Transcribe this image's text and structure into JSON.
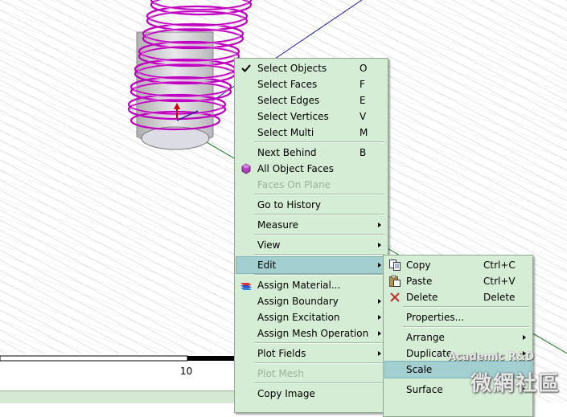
{
  "context_menu": {
    "items": [
      {
        "label": "Select Objects",
        "shortcut": "O",
        "checked": true
      },
      {
        "label": "Select Faces",
        "shortcut": "F"
      },
      {
        "label": "Select Edges",
        "shortcut": "E"
      },
      {
        "label": "Select Vertices",
        "shortcut": "V"
      },
      {
        "label": "Select Multi",
        "shortcut": "M"
      },
      {
        "label": "Next Behind",
        "shortcut": "B"
      },
      {
        "label": "All Object Faces",
        "icon": "purple-cube-icon"
      },
      {
        "label": "Faces On Plane",
        "disabled": true
      },
      {
        "label": "Go to History"
      },
      {
        "label": "Measure",
        "submenu": true
      },
      {
        "label": "View",
        "submenu": true
      },
      {
        "label": "Edit",
        "submenu": true,
        "highlighted": true
      },
      {
        "label": "Assign Material...",
        "icon": "material-layers-icon"
      },
      {
        "label": "Assign Boundary",
        "submenu": true
      },
      {
        "label": "Assign Excitation",
        "submenu": true
      },
      {
        "label": "Assign Mesh Operation",
        "submenu": true
      },
      {
        "label": "Plot Fields",
        "submenu": true
      },
      {
        "label": "Plot Mesh",
        "disabled": true
      },
      {
        "label": "Copy Image"
      }
    ]
  },
  "edit_submenu": {
    "items": [
      {
        "label": "Copy",
        "shortcut": "Ctrl+C",
        "icon": "copy-icon"
      },
      {
        "label": "Paste",
        "shortcut": "Ctrl+V",
        "icon": "paste-icon"
      },
      {
        "label": "Delete",
        "shortcut": "Delete",
        "icon": "delete-x-icon"
      },
      {
        "label": "Properties..."
      },
      {
        "label": "Arrange",
        "submenu": true
      },
      {
        "label": "Duplicate",
        "submenu": true
      },
      {
        "label": "Scale",
        "highlighted": true
      },
      {
        "label": "Surface",
        "submenu": true
      }
    ]
  },
  "ruler": {
    "label": "10"
  },
  "watermark": {
    "line1": "Academic R&D",
    "line2": "微網社區"
  },
  "colors": {
    "menu_bg": "#d5ecd5",
    "highlight": "#a3cfd0",
    "coil": "#c000c0",
    "axis_green": "#1a7a1a",
    "axis_blue": "#1a1a9a",
    "axis_red": "#cc0000"
  }
}
